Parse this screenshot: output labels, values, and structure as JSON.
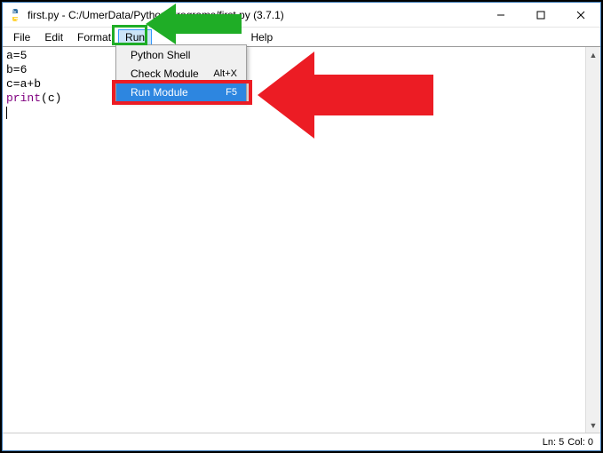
{
  "titlebar": {
    "title": "first.py - C:/UmerData/Python Programs/first.py (3.7.1)"
  },
  "menubar": {
    "file": "File",
    "edit": "Edit",
    "format": "Format",
    "run": "Run",
    "help": "Help"
  },
  "dropdown": {
    "item0": {
      "label": "Python Shell"
    },
    "item1": {
      "label": "Check Module",
      "shortcut": "Alt+X"
    },
    "item2": {
      "label": "Run Module",
      "shortcut": "F5"
    }
  },
  "code": {
    "l1": "a=5",
    "l2": "b=6",
    "l3": "c=a+b",
    "l4a": "print",
    "l4b": "(c)"
  },
  "statusbar": {
    "ln": "Ln: 5",
    "col": "Col: 0"
  }
}
